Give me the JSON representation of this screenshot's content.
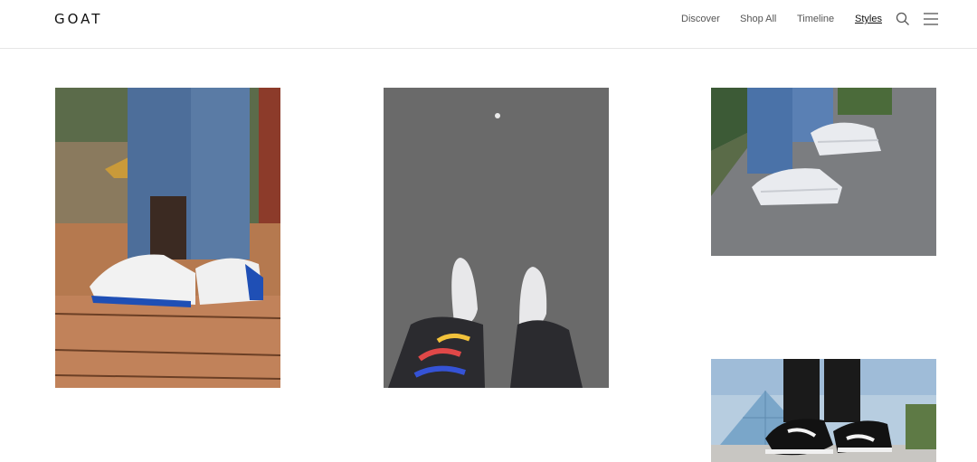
{
  "header": {
    "logo": "GOAT",
    "nav": [
      {
        "label": "Discover",
        "active": false
      },
      {
        "label": "Shop All",
        "active": false
      },
      {
        "label": "Timeline",
        "active": false
      },
      {
        "label": "Styles",
        "active": true
      }
    ],
    "icons": [
      "search-icon",
      "menu-icon"
    ]
  },
  "feed": {
    "tiles": [
      {
        "subject": "white-blue-sneakers-on-wooden-deck"
      },
      {
        "subject": "white-sneakers-on-asphalt"
      },
      {
        "subject": "white-running-sneakers-on-concrete"
      },
      {
        "subject": "black-white-sneakers-glass-pyramid"
      }
    ]
  },
  "colors": {
    "text": "#111111",
    "nav_text": "#555555",
    "border": "#e6e6e6"
  }
}
